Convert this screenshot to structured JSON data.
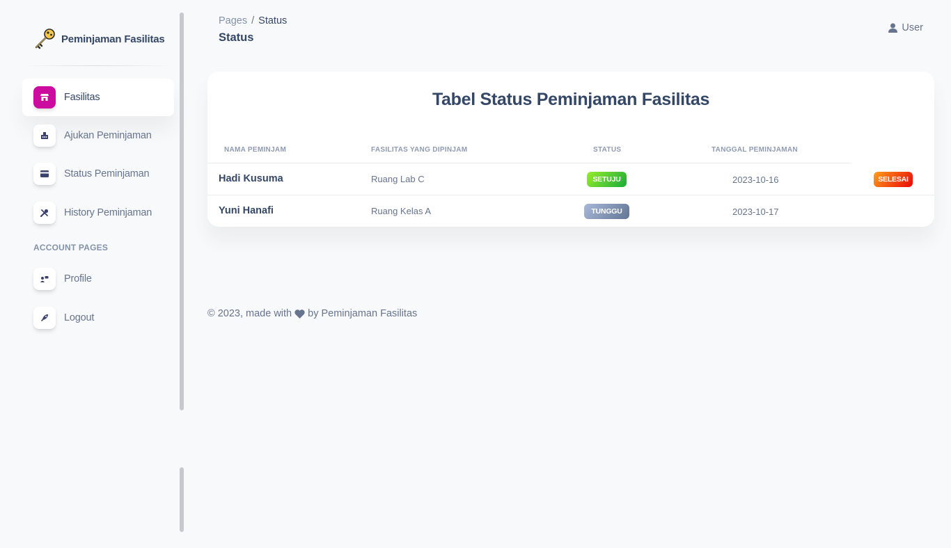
{
  "brand": {
    "name": "Peminjaman Fasilitas",
    "logo_icon": "key-icon"
  },
  "sidebar": {
    "items": [
      {
        "label": "Fasilitas",
        "icon": "shop-icon",
        "active": true
      },
      {
        "label": "Ajukan Peminjaman",
        "icon": "office-icon",
        "active": false
      },
      {
        "label": "Status Peminjaman",
        "icon": "credit-card-icon",
        "active": false
      },
      {
        "label": "History Peminjaman",
        "icon": "tools-icon",
        "active": false
      }
    ],
    "account_heading": "ACCOUNT PAGES",
    "account_items": [
      {
        "label": "Profile",
        "icon": "user-card-icon"
      },
      {
        "label": "Logout",
        "icon": "rocket-icon"
      }
    ]
  },
  "header": {
    "breadcrumb": {
      "parent": "Pages",
      "separator": "/",
      "current": "Status"
    },
    "title": "Status",
    "user_label": "User"
  },
  "table": {
    "title": "Tabel Status Peminjaman Fasilitas",
    "columns": [
      "NAMA PEMINJAM",
      "FASILITAS YANG DIPINJAM",
      "STATUS",
      "TANGGAL PEMINJAMAN"
    ],
    "rows": [
      {
        "name": "Hadi Kusuma",
        "facility": "Ruang Lab C",
        "status": "SETUJU",
        "date": "2023-10-16",
        "action": "SELESAI"
      },
      {
        "name": "Yuni Hanafi",
        "facility": "Ruang Kelas A",
        "status": "TUNGGU",
        "date": "2023-10-17",
        "action": ""
      }
    ]
  },
  "footer": {
    "prefix": "© 2023, made with",
    "suffix": "by Peminjaman Fasilitas"
  },
  "colors": {
    "primary": "#cb0c9f",
    "text": "#344767",
    "muted": "#67748e",
    "success": "#17ad37",
    "secondary": "#627594",
    "warning": "#f53939"
  }
}
